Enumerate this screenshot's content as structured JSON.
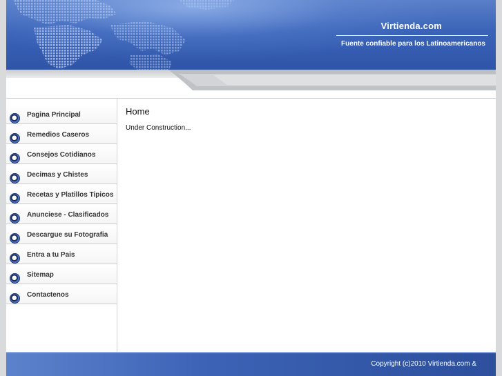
{
  "header": {
    "site_title": "Virtienda.com",
    "tagline": "Fuente confiable para los Latinoamericanos"
  },
  "sidebar": {
    "items": [
      {
        "label": "Pagina Principal"
      },
      {
        "label": "Remedios Caseros"
      },
      {
        "label": "Consejos Cotidianos"
      },
      {
        "label": "Decimas y Chistes"
      },
      {
        "label": "Recetas y Platillos Tipicos"
      },
      {
        "label": "Anunciese - Clasificados"
      },
      {
        "label": "Descargue su Fotografia"
      },
      {
        "label": "Entra a tu Pais"
      },
      {
        "label": "Sitemap"
      },
      {
        "label": "Contactenos"
      }
    ]
  },
  "main": {
    "title": "Home",
    "body": "Under Construction..."
  },
  "footer": {
    "copyright": "Copyright (c)2010 Virtienda.com &"
  },
  "colors": {
    "header_blue": "#3a63b8",
    "footer_blue": "#2d4f9c",
    "gutter_grey": "#d9dadc"
  }
}
